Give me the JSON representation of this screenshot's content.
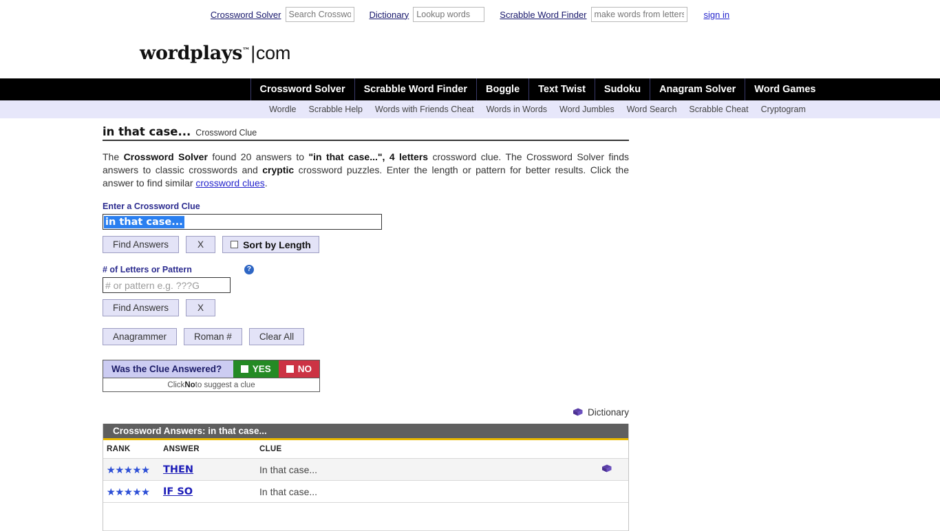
{
  "topbar": {
    "crossword_solver_label": "Crossword Solver",
    "crossword_solver_placeholder": "Search Crosswords",
    "crossword_solver_value": "",
    "dictionary_label": "Dictionary",
    "dictionary_placeholder": "Lookup words",
    "dictionary_value": "",
    "scrabble_label": "Scrabble Word Finder",
    "scrabble_placeholder": "make words from letters",
    "scrabble_value": "",
    "signin_label": "sign in"
  },
  "logo": {
    "main": "wordplays",
    "tm": "™",
    "bar": "|",
    "com": "com"
  },
  "nav_primary": [
    "Crossword Solver",
    "Scrabble Word Finder",
    "Boggle",
    "Text Twist",
    "Sudoku",
    "Anagram Solver",
    "Word Games"
  ],
  "nav_secondary": [
    "Wordle",
    "Scrabble Help",
    "Words with Friends Cheat",
    "Words in Words",
    "Word Jumbles",
    "Word Search",
    "Scrabble Cheat",
    "Cryptogram"
  ],
  "page": {
    "title": "in that case...",
    "title_sub": "Crossword Clue",
    "intro": {
      "p1": "The ",
      "b1": "Crossword Solver",
      "p2": " found 20 answers to ",
      "b2": "\"in that case...\", 4 letters",
      "p3": " crossword clue. The Crossword Solver finds answers to classic crosswords and ",
      "b3": "cryptic",
      "p4": " crossword puzzles. Enter the length or pattern for better results. Click the answer to find similar ",
      "link": "crossword clues",
      "p5": "."
    }
  },
  "form": {
    "clue_label": "Enter a Crossword Clue",
    "clue_value": "in that case...",
    "find_answers_label": "Find Answers",
    "clear_label": "X",
    "sort_by_length_label": "Sort by Length",
    "sort_checked": false,
    "pattern_label": "# of Letters or Pattern",
    "help_icon_glyph": "?",
    "pattern_placeholder": "# or pattern e.g. ???G",
    "pattern_value": "",
    "find_answers_label2": "Find Answers",
    "clear_label2": "X",
    "anagrammer_label": "Anagrammer",
    "roman_label": "Roman #",
    "clear_all_label": "Clear All"
  },
  "answered": {
    "question": "Was the Clue Answered?",
    "yes_label": "YES",
    "no_label": "NO",
    "hint_pre": "Click ",
    "hint_bold": "No",
    "hint_post": " to suggest a clue"
  },
  "dictionary_link": {
    "label": "Dictionary",
    "icon": "book-icon"
  },
  "results": {
    "header": "Crossword Answers: in that case...",
    "columns": [
      "RANK",
      "ANSWER",
      "CLUE"
    ],
    "rows": [
      {
        "rank": 5,
        "answer": "THEN",
        "clue": "In that case...",
        "has_dict_icon": true
      },
      {
        "rank": 5,
        "answer": "IF SO",
        "clue": "In that case...",
        "has_dict_icon": false
      }
    ],
    "star_glyph": "★"
  },
  "colors": {
    "nav_bar": "#000000",
    "subnav_bar": "#e7e7fa",
    "accent_link": "#2222cc",
    "yes_green": "#248a24",
    "no_red": "#cc3344",
    "results_header_gray": "#5f5f5f",
    "results_header_rule": "#e8b800",
    "selection_blue": "#2a7ff0",
    "star_blue": "#2d4fd6"
  }
}
